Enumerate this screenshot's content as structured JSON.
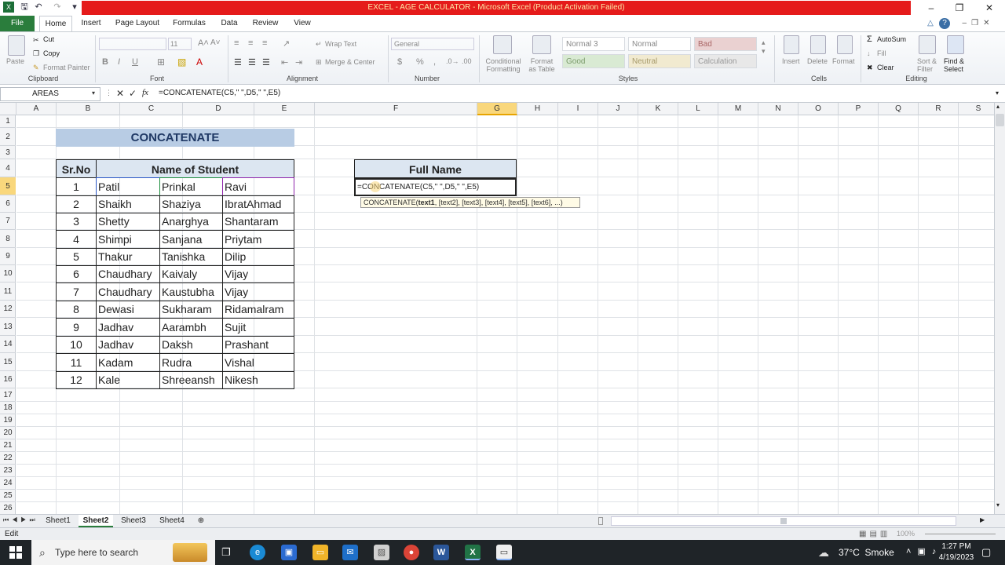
{
  "window": {
    "title": "EXCEL - AGE CALCULATOR - Microsoft Excel (Product Activation Failed)"
  },
  "ribbon_tabs": [
    "File",
    "Home",
    "Insert",
    "Page Layout",
    "Formulas",
    "Data",
    "Review",
    "View"
  ],
  "ribbon": {
    "clipboard": {
      "paste": "Paste",
      "cut": "Cut",
      "copy": "Copy",
      "format_painter": "Format Painter",
      "label": "Clipboard"
    },
    "font": {
      "size": "11",
      "label": "Font"
    },
    "alignment": {
      "wrap_text": "Wrap Text",
      "merge_center": "Merge & Center",
      "label": "Alignment"
    },
    "number": {
      "format": "General",
      "label": "Number"
    },
    "styles": {
      "conditional": "Conditional Formatting",
      "format_table": "Format as Table",
      "normal3": "Normal 3",
      "normal": "Normal",
      "bad": "Bad",
      "good": "Good",
      "neutral": "Neutral",
      "calculation": "Calculation",
      "label": "Styles"
    },
    "cells": {
      "insert": "Insert",
      "delete": "Delete",
      "format": "Format",
      "label": "Cells"
    },
    "editing": {
      "autosum": "AutoSum",
      "fill": "Fill",
      "clear": "Clear",
      "sort_filter": "Sort & Filter",
      "find_select": "Find & Select",
      "label": "Editing"
    }
  },
  "formula_bar": {
    "name_box": "AREAS",
    "formula": "=CONCATENATE(C5,\" \",D5,\" \",E5)"
  },
  "columns": [
    "A",
    "B",
    "C",
    "D",
    "E",
    "F",
    "G",
    "H",
    "I",
    "J",
    "K",
    "L",
    "M",
    "N",
    "O",
    "P",
    "Q",
    "R",
    "S"
  ],
  "rows": [
    "1",
    "2",
    "3",
    "4",
    "5",
    "6",
    "7",
    "8",
    "9",
    "10",
    "11",
    "12",
    "13",
    "14",
    "15",
    "16",
    "17",
    "18",
    "19",
    "20",
    "21",
    "22",
    "23",
    "24",
    "25",
    "26"
  ],
  "sheet": {
    "title": "CONCATENATE",
    "headers": {
      "srno": "Sr.No",
      "name": "Name of Student",
      "full_name": "Full Name"
    },
    "students": [
      {
        "no": "1",
        "c": "Patil",
        "d": "Prinkal",
        "e": "Ravi"
      },
      {
        "no": "2",
        "c": "Shaikh",
        "d": "Shaziya",
        "e": "IbratAhmad"
      },
      {
        "no": "3",
        "c": "Shetty",
        "d": "Anarghya",
        "e": "Shantaram"
      },
      {
        "no": "4",
        "c": "Shimpi",
        "d": "Sanjana",
        "e": "Priytam"
      },
      {
        "no": "5",
        "c": "Thakur",
        "d": "Tanishka",
        "e": "Dilip"
      },
      {
        "no": "6",
        "c": "Chaudhary",
        "d": "Kaivaly",
        "e": "Vijay"
      },
      {
        "no": "7",
        "c": "Chaudhary",
        "d": "Kaustubha",
        "e": "Vijay"
      },
      {
        "no": "8",
        "c": "Dewasi",
        "d": "Sukharam",
        "e": "Ridamalram"
      },
      {
        "no": "9",
        "c": "Jadhav",
        "d": "Aarambh",
        "e": "Sujit"
      },
      {
        "no": "10",
        "c": "Jadhav",
        "d": "Daksh",
        "e": "Prashant"
      },
      {
        "no": "11",
        "c": "Kadam",
        "d": "Rudra",
        "e": "Vishal"
      },
      {
        "no": "12",
        "c": "Kale",
        "d": "Shreeansh",
        "e": "Nikesh"
      }
    ],
    "editing_cell": "=CONCATENATE(C5,\" \",D5,\" \",E5)",
    "tooltip": {
      "fn": "CONCATENATE(",
      "arg1": "text1",
      "rest": ", [text2], [text3], [text4], [text5], [text6], ...)"
    }
  },
  "sheet_tabs": [
    "Sheet1",
    "Sheet2",
    "Sheet3",
    "Sheet4"
  ],
  "status": {
    "mode": "Edit",
    "zoom": "100%"
  },
  "taskbar": {
    "search_placeholder": "Type here to search",
    "weather": "37°C  Smoke",
    "time": "1:27 PM",
    "date": "4/19/2023"
  },
  "colors": {
    "excel_green": "#2a7d3c",
    "title_band": "#e51b1b",
    "header_fill": "#dce6f1",
    "title_fill": "#b8cce4",
    "title_text": "#1f3864",
    "selection": "#f9d77c"
  }
}
